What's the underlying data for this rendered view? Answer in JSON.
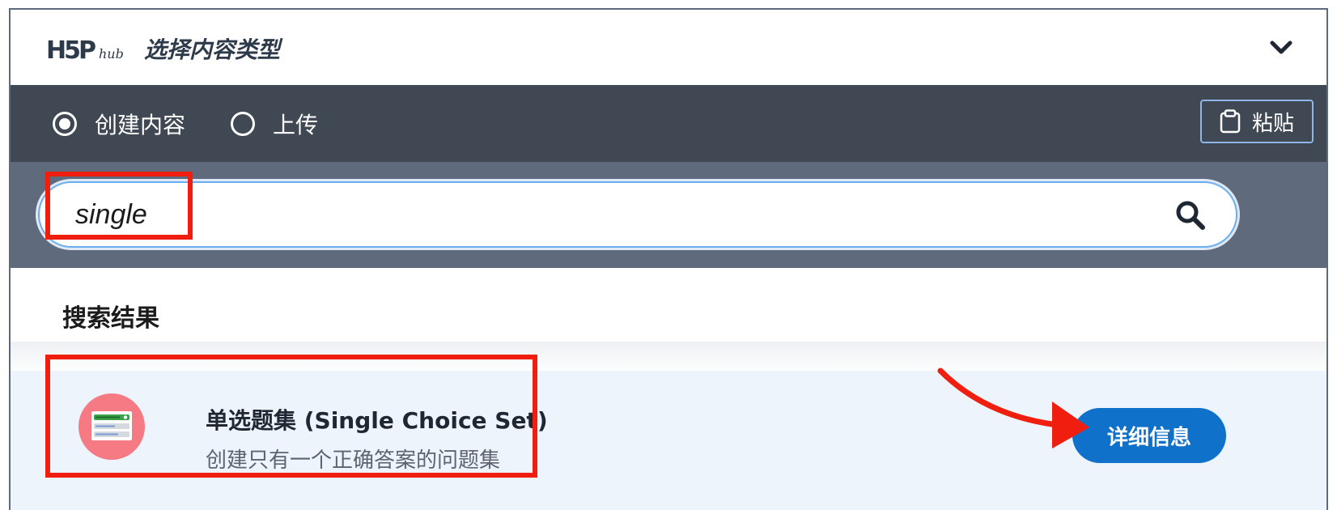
{
  "header": {
    "logo_main": "H5P",
    "logo_sub": "hub",
    "title": "选择内容类型"
  },
  "tabs": [
    {
      "label": "创建内容",
      "selected": true
    },
    {
      "label": "上传",
      "selected": false
    }
  ],
  "paste": {
    "label": "粘贴"
  },
  "search": {
    "value": "single"
  },
  "results": {
    "title": "搜索结果",
    "items": [
      {
        "name": "单选题集 (Single Choice Set)",
        "description": "创建只有一个正确答案的问题集",
        "details_label": "详细信息"
      }
    ]
  },
  "colors": {
    "tabbar": "#404854",
    "searchbar": "#5f6b7c",
    "accent": "#1071cb",
    "highlight": "#f01e0e",
    "result_icon_bg": "#f57a84"
  }
}
